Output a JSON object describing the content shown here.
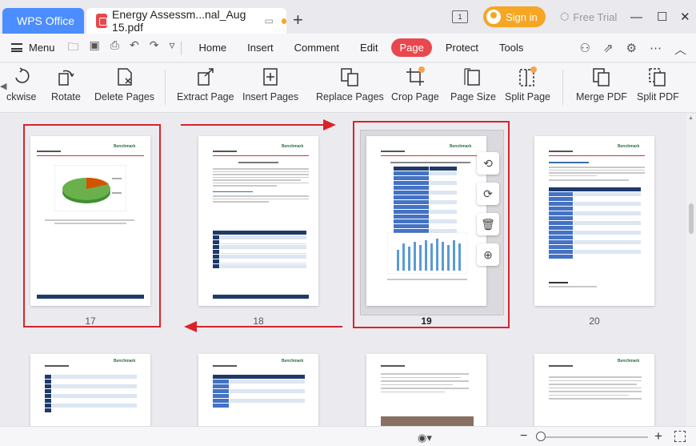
{
  "titlebar": {
    "app_tab": "WPS Office",
    "doc_tab": "Energy Assessm...nal_Aug 15.pdf",
    "new_tab": "+",
    "sign_in": "Sign in",
    "free_trial": "Free Trial",
    "minimize": "—",
    "maximize": "☐",
    "close": "✕"
  },
  "menubar": {
    "menu_label": "Menu",
    "tabs": [
      "Home",
      "Insert",
      "Comment",
      "Edit",
      "Page",
      "Protect",
      "Tools"
    ],
    "active_tab": "Page"
  },
  "ribbon": {
    "items": [
      "ckwise",
      "Rotate",
      "Delete Pages",
      "Extract Page",
      "Insert Pages",
      "Replace Pages",
      "Crop Page",
      "Page Size",
      "Split Page",
      "Merge PDF",
      "Split PDF"
    ]
  },
  "pages": {
    "row1": [
      "17",
      "18",
      "19",
      "20"
    ],
    "selected": "19"
  },
  "colors": {
    "accent": "#e8484d",
    "selection": "#d9232a",
    "wps_blue": "#4c8dff",
    "signin": "#f6a623"
  },
  "icons": [
    "pdf-icon",
    "monitor-icon",
    "user-add-icon",
    "share-icon",
    "settings-icon",
    "more-icon",
    "chevron-up-icon",
    "rotate-left-icon",
    "rotate-right-icon",
    "delete-icon",
    "insert-icon",
    "eye-icon",
    "fit-icon"
  ]
}
